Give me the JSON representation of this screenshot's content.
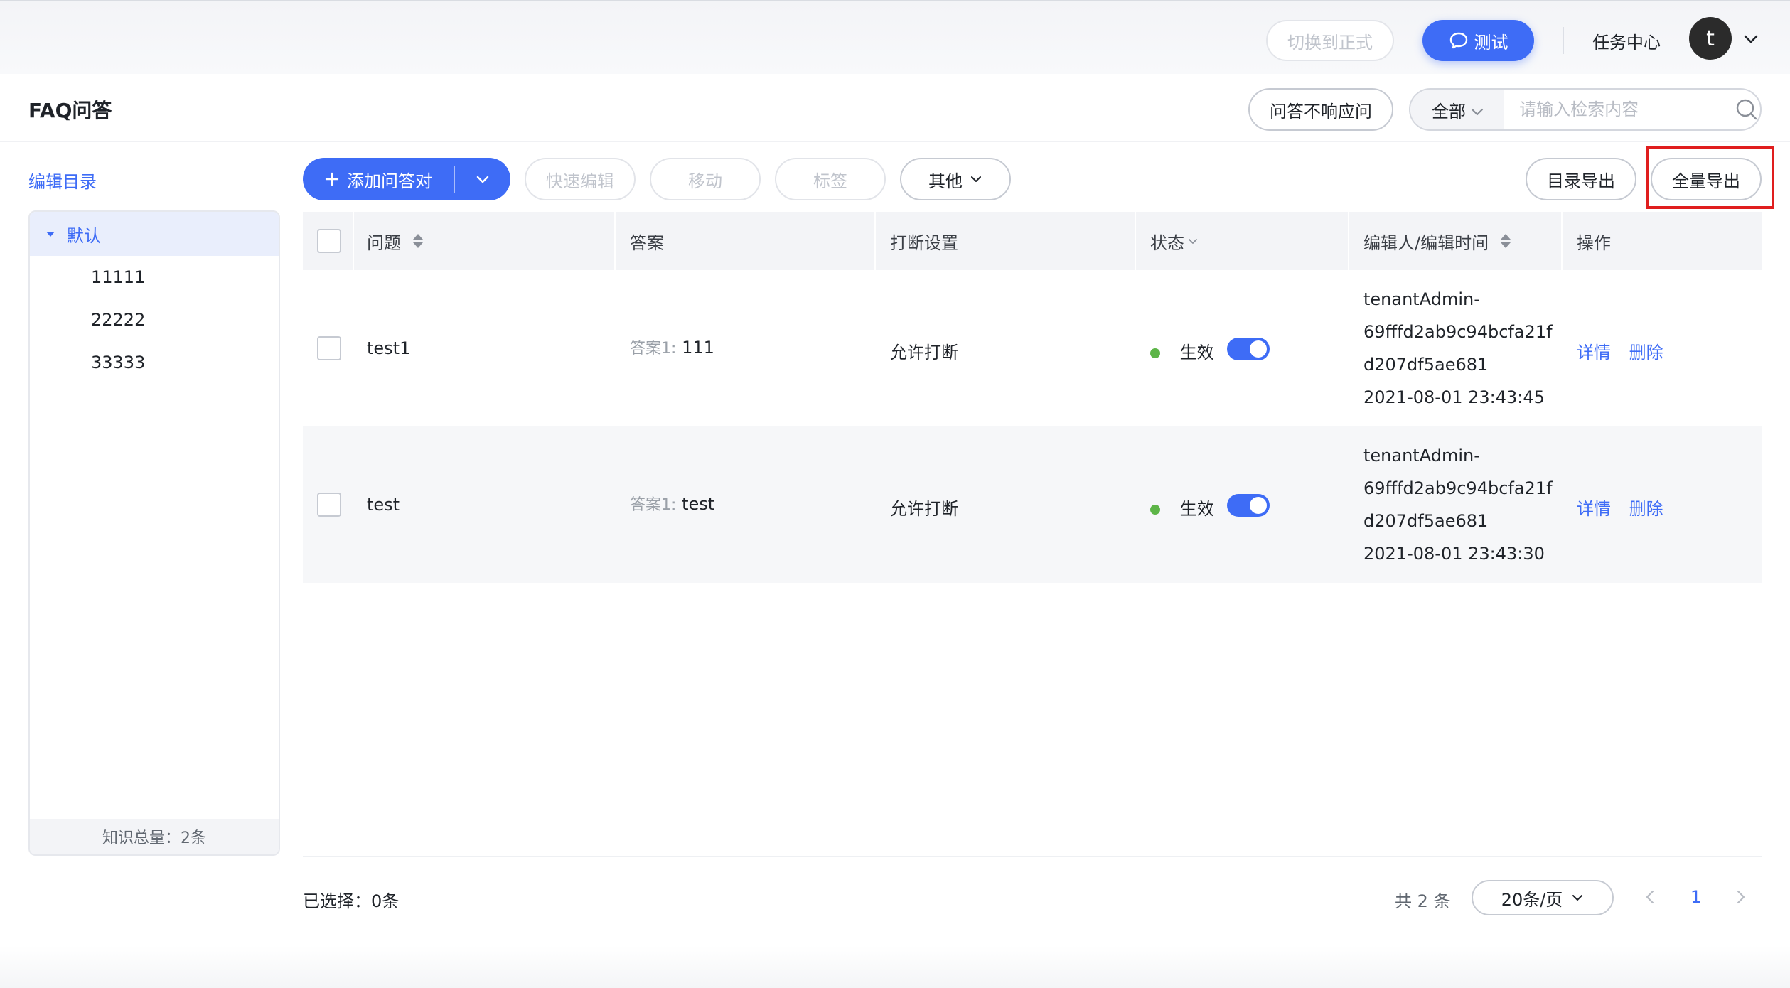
{
  "topbar": {
    "switch_label": "切换到正式",
    "test_label": "测试",
    "task_center": "任务中心",
    "avatar_letter": "t"
  },
  "header": {
    "title": "FAQ问答",
    "unresponsive_label": "问答不响应问",
    "scope_value": "全部",
    "search_placeholder": "请输入检索内容"
  },
  "sidebar": {
    "edit_dir": "编辑目录",
    "root": "默认",
    "nodes": [
      "11111",
      "22222",
      "33333"
    ],
    "footer": "知识总量：2条"
  },
  "toolbar": {
    "add_label": "添加问答对",
    "quick_edit": "快速编辑",
    "move": "移动",
    "tag": "标签",
    "other": "其他",
    "dir_export": "目录导出",
    "full_export": "全量导出"
  },
  "table": {
    "headers": {
      "question": "问题",
      "answer": "答案",
      "interrupt": "打断设置",
      "status": "状态",
      "editor": "编辑人/编辑时间",
      "actions": "操作"
    },
    "rows": [
      {
        "question": "test1",
        "answer_label": "答案1:",
        "answer": "111",
        "interrupt": "允许打断",
        "status": "生效",
        "editor_l1": "tenantAdmin-",
        "editor_l2": "69fffd2ab9c94bcfa21f",
        "editor_l3": "d207df5ae681",
        "edit_time": "2021-08-01 23:43:45",
        "detail": "详情",
        "delete": "删除"
      },
      {
        "question": "test",
        "answer_label": "答案1:",
        "answer": "test",
        "interrupt": "允许打断",
        "status": "生效",
        "editor_l1": "tenantAdmin-",
        "editor_l2": "69fffd2ab9c94bcfa21f",
        "editor_l3": "d207df5ae681",
        "edit_time": "2021-08-01 23:43:30",
        "detail": "详情",
        "delete": "删除"
      }
    ]
  },
  "footer": {
    "selected": "已选择：0条",
    "total": "共 2 条",
    "page_size": "20条/页",
    "current_page": "1"
  },
  "colors": {
    "accent": "#3e6cf6",
    "status_active": "#5db548",
    "highlight": "#e01e1e"
  }
}
